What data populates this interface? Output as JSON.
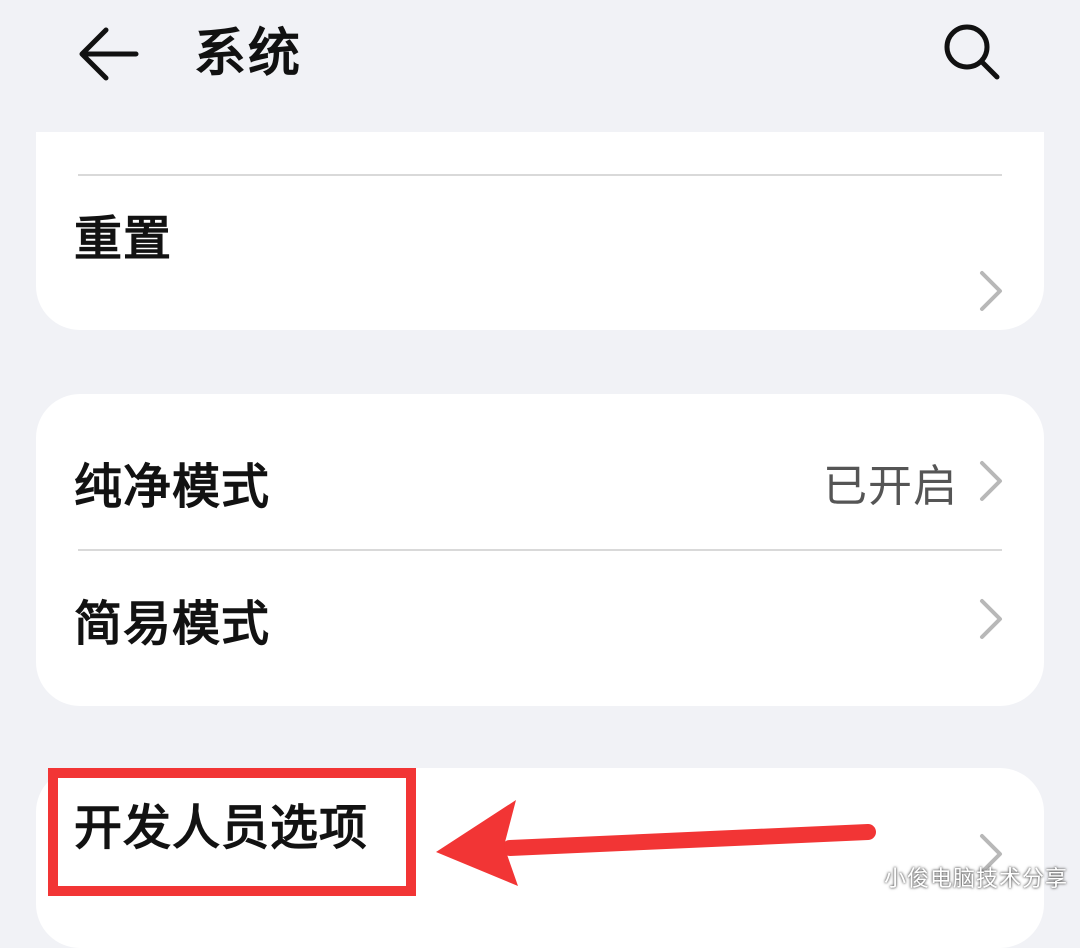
{
  "header": {
    "title": "系统",
    "back_icon": "arrow-left-icon",
    "search_icon": "search-icon"
  },
  "group1": {
    "items": [
      {
        "label": "重置",
        "icon": "chevron-right-icon"
      }
    ]
  },
  "group2": {
    "items": [
      {
        "label": "纯净模式",
        "value": "已开启",
        "icon": "chevron-right-icon"
      },
      {
        "label": "简易模式",
        "icon": "chevron-right-icon"
      }
    ]
  },
  "group3": {
    "items": [
      {
        "label": "开发人员选项",
        "icon": "chevron-right-icon"
      }
    ]
  },
  "annotation": {
    "color": "#f23535"
  },
  "watermark": "小俊电脑技术分享",
  "colors": {
    "background": "#f1f2f6",
    "card": "#ffffff",
    "divider": "#d9d9d9",
    "secondary_text": "#555555",
    "annotation_red": "#f23535"
  }
}
